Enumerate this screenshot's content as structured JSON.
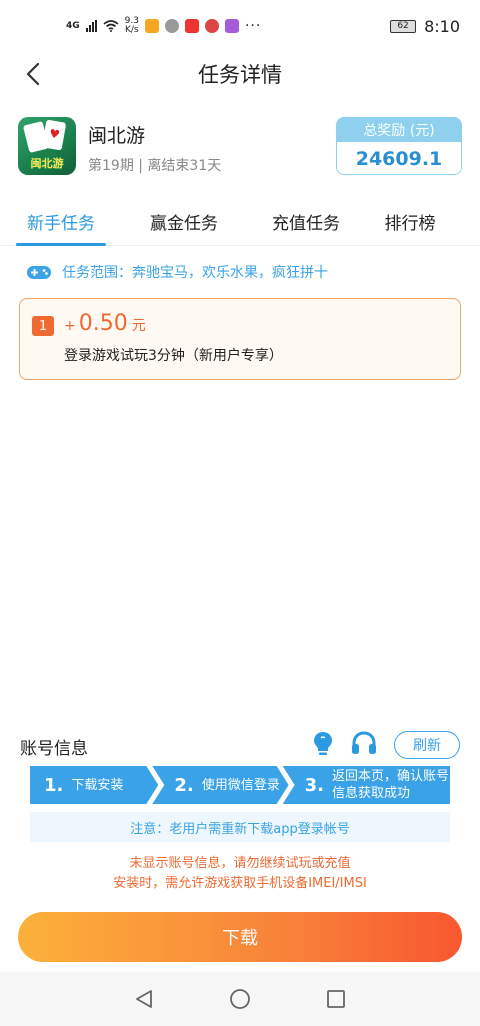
{
  "status_bar": {
    "network": "4G",
    "speed_value": "9.3",
    "speed_unit": "K/s",
    "battery": "62",
    "time": "8:10"
  },
  "header": {
    "title": "任务详情"
  },
  "game": {
    "name": "闽北游",
    "icon_text": "闽北游",
    "subtitle": "第19期 | 离结束31天",
    "reward_label": "总奖励 (元)",
    "reward_value": "24609.1"
  },
  "tabs": [
    {
      "label": "新手任务",
      "active": true
    },
    {
      "label": "赢金任务",
      "active": false
    },
    {
      "label": "充值任务",
      "active": false
    },
    {
      "label": "排行榜",
      "active": false
    }
  ],
  "scope": {
    "text": "任务范围：奔驰宝马，欢乐水果，疯狂拼十"
  },
  "task": {
    "number": "1",
    "plus": "+",
    "amount": "0.50",
    "unit": "元",
    "description": "登录游戏试玩3分钟（新用户专享）"
  },
  "account": {
    "title": "账号信息",
    "refresh_label": "刷新",
    "steps": [
      {
        "num": "1.",
        "text": "下载安装"
      },
      {
        "num": "2.",
        "text": "使用微信登录"
      },
      {
        "num": "3.",
        "text": "返回本页，确认账号信息获取成功"
      }
    ],
    "notice": "注意：老用户需重新下载app登录帐号",
    "warning_line1": "未显示账号信息，请勿继续试玩或充值",
    "warning_line2": "安装时，需允许游戏获取手机设备IMEI/IMSI"
  },
  "download_label": "下载",
  "colors": {
    "accent": "#2c9ae0",
    "orange": "#ee6a32"
  }
}
